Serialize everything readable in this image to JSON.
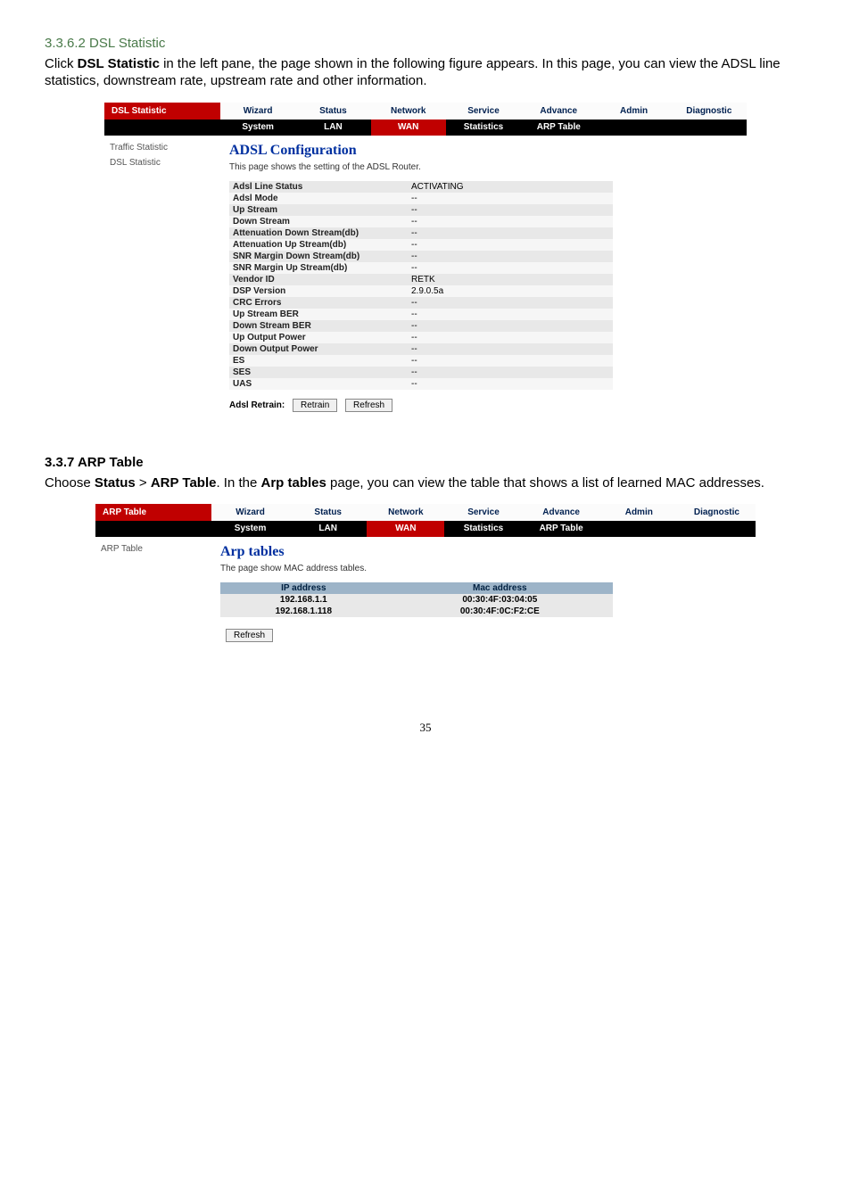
{
  "section1": {
    "number": "3.3.6.2 DSL Statistic",
    "para_pre": "Click ",
    "para_b1": "DSL Statistic",
    "para_mid": " in the left pane, the page shown in the following figure appears. In this page, you can view the ADSL line statistics, downstream rate, upstream rate and other information."
  },
  "shot1": {
    "title": "DSL Statistic",
    "nav": [
      "Wizard",
      "Status",
      "Network",
      "Service",
      "Advance",
      "Admin",
      "Diagnostic"
    ],
    "subnav": [
      "System",
      "LAN",
      "WAN",
      "Statistics",
      "ARP Table"
    ],
    "side": [
      "Traffic Statistic",
      "DSL Statistic"
    ],
    "cfg_title": "ADSL Configuration",
    "cfg_sub": "This page shows the setting of the ADSL Router.",
    "rows": [
      [
        "Adsl Line Status",
        "ACTIVATING"
      ],
      [
        "Adsl Mode",
        "--"
      ],
      [
        "Up Stream",
        "--"
      ],
      [
        "Down Stream",
        "--"
      ],
      [
        "Attenuation Down Stream(db)",
        "--"
      ],
      [
        "Attenuation Up Stream(db)",
        "--"
      ],
      [
        "SNR Margin Down Stream(db)",
        "--"
      ],
      [
        "SNR Margin Up Stream(db)",
        "--"
      ],
      [
        "Vendor ID",
        "RETK"
      ],
      [
        "DSP Version",
        "2.9.0.5a"
      ],
      [
        "CRC Errors",
        "--"
      ],
      [
        "Up Stream BER",
        "--"
      ],
      [
        "Down Stream BER",
        "--"
      ],
      [
        "Up Output Power",
        "--"
      ],
      [
        "Down Output Power",
        "--"
      ],
      [
        "ES",
        "--"
      ],
      [
        "SES",
        "--"
      ],
      [
        "UAS",
        "--"
      ]
    ],
    "retrain_label": "Adsl Retrain:",
    "btn1": "Retrain",
    "btn2": "Refresh"
  },
  "section2": {
    "heading": "3.3.7 ARP Table",
    "p_pre": "Choose ",
    "p_b1": "Status",
    "p_gt": " > ",
    "p_b2": "ARP Table",
    "p_mid": ". In the ",
    "p_b3": "Arp tables",
    "p_post": " page, you can view the table that shows a list of learned MAC addresses."
  },
  "shot2": {
    "title": "ARP Table",
    "nav": [
      "Wizard",
      "Status",
      "Network",
      "Service",
      "Advance",
      "Admin",
      "Diagnostic"
    ],
    "subnav": [
      "System",
      "LAN",
      "WAN",
      "Statistics",
      "ARP Table"
    ],
    "side": [
      "ARP Table"
    ],
    "cfg_title": "Arp tables",
    "cfg_sub": "The page show MAC address tables.",
    "th1": "IP address",
    "th2": "Mac address",
    "rows": [
      [
        "192.168.1.1",
        "00:30:4F:03:04:05"
      ],
      [
        "192.168.1.118",
        "00:30:4F:0C:F2:CE"
      ]
    ],
    "btn": "Refresh"
  },
  "pagenum": "35"
}
